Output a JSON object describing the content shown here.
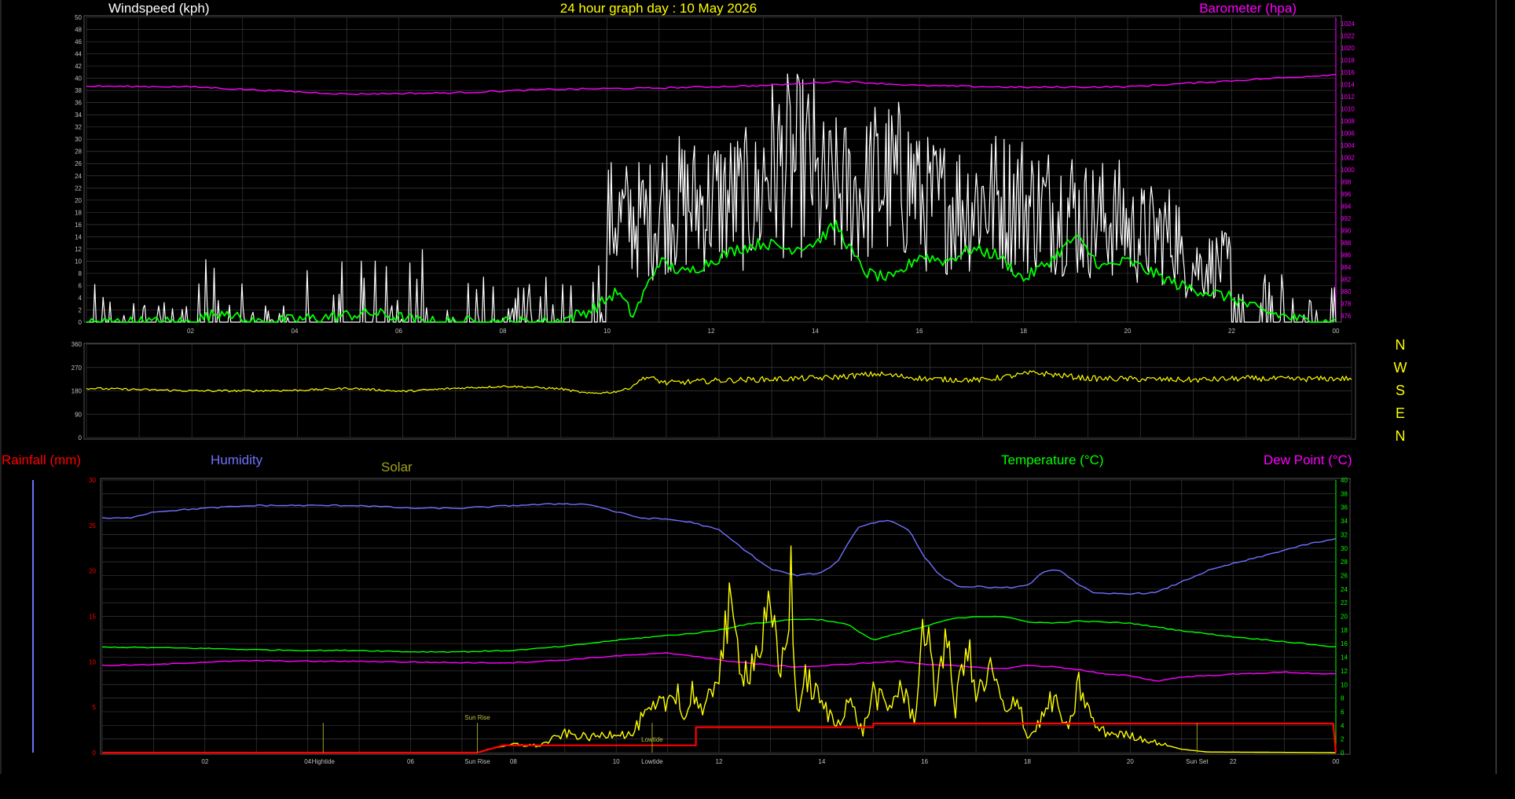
{
  "titles": {
    "main": "24 hour graph day : 10 May 2026",
    "windspeed": "Windspeed (kph)",
    "barometer": "Barometer (hpa)",
    "rainfall": "Rainfall (mm)",
    "humidity": "Humidity",
    "solar": "Solar",
    "temperature": "Temperature (°C)",
    "dewpoint": "Dew Point (°C)"
  },
  "compass": [
    "N",
    "W",
    "S",
    "E",
    "N"
  ],
  "colors": {
    "background": "#000000",
    "grid": "#3a3a3a",
    "white": "#ffffff",
    "yellow": "#ffff00",
    "magenta": "#ff00ff",
    "green": "#00ff00",
    "red": "#ff0000",
    "humidity": "#7070ff",
    "solar": "#a0a020",
    "axis_text": "#c0c0c0"
  },
  "markers": {
    "sunrise": "Sun Rise",
    "sunset": "Sun Set",
    "hightide": "Hightide",
    "lowtide": "Lowtide"
  },
  "chart_data": [
    {
      "type": "line",
      "id": "wind",
      "title": "24 hour graph day : 10 May 2026",
      "x_ticks": [
        "02",
        "04",
        "06",
        "08",
        "10",
        "12",
        "14",
        "16",
        "18",
        "20",
        "22",
        "00"
      ],
      "xlim_hours": [
        0,
        24
      ],
      "y_left": {
        "label": "Windspeed (kph)",
        "range": [
          0,
          50
        ],
        "step": 2
      },
      "y_right": {
        "label": "Barometer (hpa)",
        "range": [
          975,
          1025
        ],
        "step": 2
      },
      "grid": true,
      "series": [
        {
          "name": "Windspeed (kph)",
          "color": "#ffffff",
          "axis": "left",
          "values_hourly_peak": [
            7,
            4,
            11,
            3,
            11,
            11,
            12,
            8,
            8,
            11,
            27,
            31,
            32,
            41,
            34,
            37,
            31,
            32,
            30,
            27,
            23,
            15,
            8,
            6
          ]
        },
        {
          "name": "Windspeed avg",
          "color": "#00ff00",
          "axis": "left",
          "x": [
            0,
            1,
            2,
            2.7,
            3,
            3.5,
            5.5,
            6.5,
            8,
            9,
            9.7,
            10.2,
            10.5,
            11,
            11.5,
            12,
            12.5,
            13,
            13.5,
            14,
            14.4,
            14.8,
            15,
            15.5,
            16,
            16.5,
            17,
            17.5,
            18,
            18.5,
            19,
            19.5,
            20,
            20.5,
            21,
            21.5,
            22,
            22.5,
            23,
            23.5,
            24
          ],
          "values": [
            0,
            0,
            0,
            2,
            0,
            0,
            1.5,
            0,
            0,
            0,
            2,
            5,
            1,
            10,
            8,
            10,
            12,
            13,
            12,
            13,
            16,
            10,
            8,
            7,
            11,
            10,
            12,
            11,
            7,
            10,
            14,
            9,
            10,
            8,
            6,
            5,
            4,
            2,
            1,
            0,
            0
          ]
        },
        {
          "name": "Barometer (hpa)",
          "color": "#ff00ff",
          "axis": "right",
          "x": [
            0,
            2,
            4,
            5,
            7,
            9,
            11,
            13,
            14.5,
            16,
            18,
            20,
            22,
            24
          ],
          "values": [
            1013.7,
            1013.6,
            1012.8,
            1012.4,
            1012.6,
            1013.2,
            1013.4,
            1013.8,
            1014.5,
            1013.8,
            1013.5,
            1013.6,
            1014.6,
            1015.6
          ]
        }
      ]
    },
    {
      "type": "line",
      "id": "direction",
      "x_ticks": [
        "02",
        "04",
        "06",
        "08",
        "10",
        "12",
        "14",
        "16",
        "18",
        "20",
        "22",
        "00"
      ],
      "xlim_hours": [
        0,
        24
      ],
      "y_left": {
        "label": "",
        "range": [
          0,
          360
        ],
        "ticks": [
          0,
          90,
          180,
          270,
          360
        ]
      },
      "compass_labels": [
        "N",
        "W",
        "S",
        "E",
        "N"
      ],
      "grid": true,
      "series": [
        {
          "name": "Wind direction",
          "color": "#ffff00",
          "x": [
            0,
            1,
            2,
            3,
            4,
            5,
            6,
            7,
            8,
            9,
            9.5,
            10,
            10.3,
            10.6,
            11,
            12,
            13,
            14,
            15,
            16,
            17,
            18,
            19,
            20,
            21,
            22,
            23,
            24
          ],
          "values": [
            190,
            185,
            180,
            180,
            182,
            190,
            178,
            190,
            198,
            188,
            170,
            175,
            190,
            235,
            210,
            220,
            225,
            230,
            245,
            225,
            222,
            250,
            228,
            225,
            222,
            228,
            225,
            228
          ]
        }
      ]
    },
    {
      "type": "line",
      "id": "lower",
      "x_ticks": [
        "02",
        "04",
        "06",
        "08",
        "10",
        "12",
        "14",
        "16",
        "18",
        "20",
        "22",
        "00"
      ],
      "xlim_hours": [
        0,
        24
      ],
      "y_left": {
        "label": "Rainfall (mm)",
        "range": [
          0,
          30
        ],
        "ticks": [
          0,
          5,
          10,
          15,
          20,
          25,
          30
        ]
      },
      "y_right": {
        "label": "Temperature (°C)",
        "range": [
          0,
          40
        ],
        "step": 2
      },
      "grid": true,
      "events": [
        {
          "label": "Sun Rise",
          "hour": 7.3
        },
        {
          "label": "Sun Set",
          "hour": 21.3
        },
        {
          "label": "Hightide",
          "hour": 4.3
        },
        {
          "label": "Lowtide",
          "hour": 10.7
        }
      ],
      "series": [
        {
          "name": "Humidity",
          "color": "#7070ff",
          "axis": "left",
          "x": [
            0,
            0.5,
            1,
            2,
            3,
            4,
            5,
            6,
            7,
            8,
            9,
            9.5,
            10,
            10.5,
            11,
            11.5,
            12,
            12.5,
            13,
            13.5,
            14,
            14.3,
            14.7,
            15,
            15.3,
            15.7,
            16,
            16.3,
            16.7,
            17,
            17.5,
            18,
            18.3,
            18.6,
            19,
            19.3,
            19.7,
            20,
            20.5,
            21,
            21.5,
            22,
            22.5,
            23,
            23.5,
            24
          ],
          "values": [
            25.8,
            25.8,
            26.5,
            26.9,
            27.2,
            27.2,
            27.2,
            26.9,
            26.9,
            27.2,
            27.4,
            27.3,
            26.5,
            25.8,
            25.7,
            25.3,
            24.5,
            22.3,
            20.2,
            19.5,
            19.8,
            21.0,
            24.8,
            25.3,
            25.6,
            24.5,
            21.5,
            19.5,
            18.2,
            18.3,
            18.1,
            18.4,
            19.8,
            20.2,
            18.5,
            17.5,
            17.5,
            17.5,
            17.6,
            18.8,
            20.0,
            20.8,
            21.5,
            22.3,
            23.0,
            23.5
          ]
        },
        {
          "name": "Temperature (°C)",
          "color": "#00ff00",
          "axis": "right",
          "x": [
            0,
            1,
            2,
            3,
            4,
            5,
            6,
            7,
            8,
            9,
            10,
            11,
            11.5,
            12,
            12.5,
            13,
            13.5,
            14,
            14.5,
            15,
            15.5,
            16,
            16.5,
            17,
            17.5,
            18,
            18.5,
            19,
            20,
            21,
            22,
            23,
            24
          ],
          "values": [
            15.5,
            15.4,
            15.3,
            15.1,
            15.0,
            15.0,
            14.8,
            14.8,
            15.0,
            15.6,
            16.5,
            17.2,
            17.5,
            18.0,
            18.8,
            19.2,
            19.6,
            19.5,
            18.8,
            16.5,
            17.5,
            18.5,
            19.6,
            20.0,
            20.0,
            19.2,
            19.0,
            19.3,
            19.0,
            17.9,
            17.0,
            16.3,
            15.5
          ]
        },
        {
          "name": "Dew Point (°C)",
          "color": "#ff00ff",
          "axis": "right",
          "x": [
            0,
            1,
            2,
            3,
            4,
            5,
            6,
            7,
            8,
            9,
            10,
            11,
            11.5,
            12,
            12.5,
            13,
            13.5,
            14,
            14.5,
            15,
            15.5,
            16,
            16.5,
            17,
            17.5,
            18,
            18.5,
            19,
            19.5,
            20,
            20.5,
            21,
            22,
            23,
            24
          ],
          "values": [
            12.8,
            12.9,
            13.3,
            13.5,
            13.4,
            13.4,
            13.3,
            13.2,
            13.2,
            13.6,
            14.2,
            14.6,
            14.2,
            13.6,
            13.2,
            12.8,
            12.6,
            12.7,
            13.0,
            13.2,
            13.4,
            13.0,
            12.8,
            12.5,
            12.3,
            12.8,
            12.6,
            12.2,
            11.5,
            11.3,
            10.5,
            11.1,
            11.5,
            11.8,
            11.5
          ]
        },
        {
          "name": "Solar",
          "color": "#ffff00",
          "axis": "right",
          "x": [
            0,
            7.3,
            7.5,
            8,
            8.5,
            9,
            9.5,
            10,
            10.3,
            10.5,
            11,
            11.2,
            11.3,
            11.5,
            11.7,
            12.0,
            12.2,
            12.5,
            12.7,
            13.0,
            13.2,
            13.4,
            13.5,
            13.7,
            14.0,
            14.3,
            14.5,
            14.8,
            15.0,
            15.3,
            15.5,
            15.8,
            16.0,
            16.2,
            16.4,
            16.6,
            16.8,
            17.0,
            17.3,
            17.6,
            17.8,
            18.0,
            18.2,
            18.5,
            18.8,
            19.0,
            19.3,
            19.5,
            20.0,
            20.5,
            21.0,
            21.5,
            24
          ],
          "values": [
            0,
            0,
            0.5,
            1.2,
            1.0,
            2.8,
            2.2,
            3.0,
            2.5,
            5.0,
            7.5,
            10.0,
            4.0,
            9.5,
            5.0,
            13.0,
            20.0,
            12.0,
            14.0,
            20.0,
            11.0,
            25.0,
            6.0,
            11.0,
            7.0,
            4.0,
            8.0,
            3.0,
            9.0,
            6.0,
            10.0,
            5.0,
            20.0,
            8.0,
            18.0,
            6.0,
            17.0,
            8.0,
            12.0,
            5.0,
            9.0,
            2.0,
            4.0,
            8.0,
            3.0,
            10.0,
            4.0,
            3.0,
            2.5,
            1.5,
            0.5,
            0.1,
            0
          ]
        },
        {
          "name": "Rainfall (mm)",
          "color": "#ff0000",
          "axis": "left",
          "x": [
            0,
            7.3,
            7.8,
            8.0,
            11.55,
            11.55,
            15.0,
            15.0,
            23.95,
            24
          ],
          "values": [
            0,
            0,
            0.4,
            0.4,
            0.4,
            1.4,
            1.4,
            1.6,
            1.6,
            0
          ]
        }
      ]
    }
  ]
}
